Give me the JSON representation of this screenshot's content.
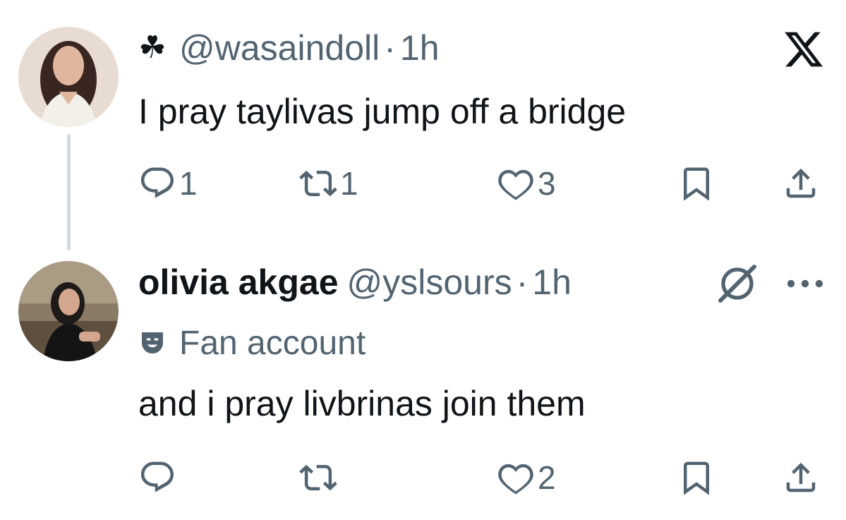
{
  "colors": {
    "text_primary": "#0f1419",
    "text_secondary": "#536471",
    "thread_line": "#cfd9de",
    "background": "#ffffff"
  },
  "tweets": [
    {
      "handle": "@wasaindoll",
      "prefix_icon": "shamrock-icon",
      "prefix_symbol": "☘",
      "separator": "·",
      "time": "1h",
      "text": "I pray taylivas jump off a bridge",
      "actions": {
        "reply_count": "1",
        "retweet_count": "1",
        "like_count": "3"
      },
      "top_right_icon": "x-logo-icon"
    },
    {
      "display_name": "olivia akgae",
      "handle": "@yslsours",
      "separator": "·",
      "time": "1h",
      "badge_icon": "theater-mask-icon",
      "badge_label": "Fan account",
      "text": "and i pray livbrinas join them",
      "actions": {
        "reply_count": "",
        "retweet_count": "",
        "like_count": "2"
      },
      "top_right_icons": [
        "grok-icon",
        "more-icon"
      ]
    }
  ]
}
